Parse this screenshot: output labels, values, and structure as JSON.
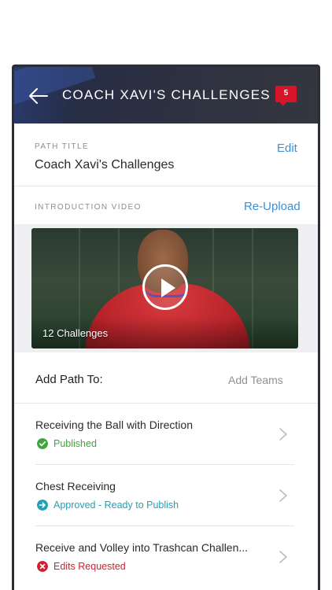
{
  "header": {
    "title": "COACH XAVI'S CHALLENGES",
    "notification_count": "5"
  },
  "path_title": {
    "label": "PATH TITLE",
    "value": "Coach Xavi's Challenges",
    "edit_label": "Edit"
  },
  "intro_video": {
    "label": "INTRODUCTION VIDEO",
    "reupload_label": "Re-Upload",
    "caption": "12 Challenges"
  },
  "add_path": {
    "label": "Add Path To:",
    "add_teams_label": "Add Teams"
  },
  "challenges": [
    {
      "name": "Receiving the Ball with Direction",
      "status": "Published",
      "status_color": "#3fa63c",
      "status_icon": "check-circle-icon"
    },
    {
      "name": "Chest Receiving",
      "status": "Approved - Ready to Publish",
      "status_color": "#1ea2b8",
      "status_icon": "arrow-circle-icon"
    },
    {
      "name": "Receive and Volley into Trashcan Challen...",
      "status": "Edits Requested",
      "status_color": "#d1202f",
      "status_icon": "x-circle-icon"
    }
  ],
  "colors": {
    "accent": "#3d8fd6",
    "badge": "#d7152a",
    "header_bg": "#2e3140"
  }
}
